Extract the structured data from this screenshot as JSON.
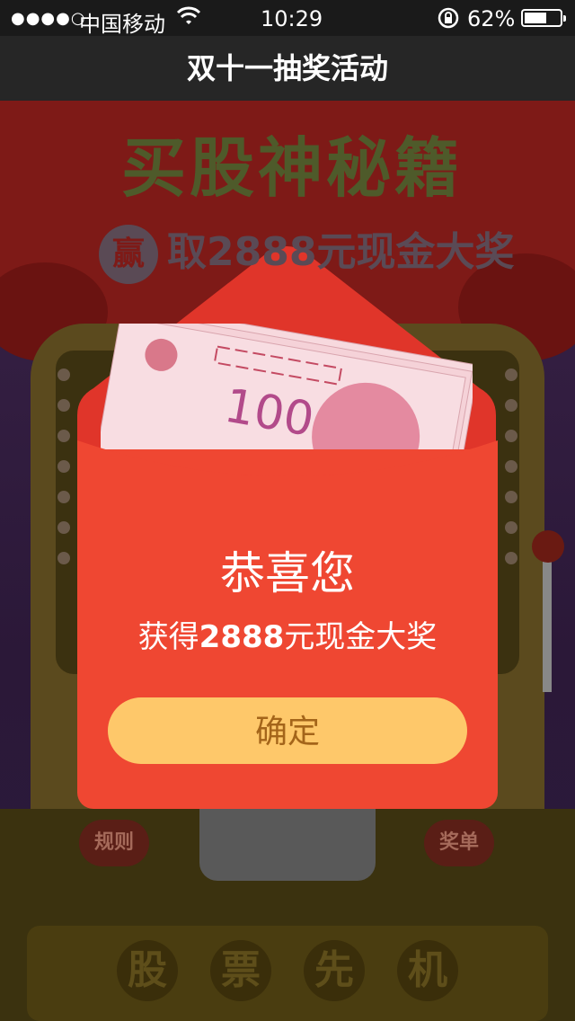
{
  "status_bar": {
    "signal": "●●●●○",
    "carrier": "中国移动",
    "time": "10:29",
    "battery_percent": "62%",
    "battery_level": 0.62
  },
  "nav": {
    "title": "双十一抽奖活动"
  },
  "banner": {
    "title": "买股神秘籍",
    "badge": "赢",
    "subtitle": "取2888元现金大奖"
  },
  "machine": {
    "rule_button": "规则",
    "prize_list_button": "奖单",
    "base_chars": [
      "股",
      "票",
      "先",
      "机"
    ]
  },
  "dialog": {
    "heading": "恭喜您",
    "prize_prefix": "获得",
    "prize_amount": "2888",
    "prize_suffix": "元现金大奖",
    "confirm_label": "确定"
  },
  "banknote": {
    "denomination": "100"
  },
  "colors": {
    "envelope": "#ef4732",
    "confirm_bg": "#fec86a",
    "confirm_text": "#a4651a"
  }
}
